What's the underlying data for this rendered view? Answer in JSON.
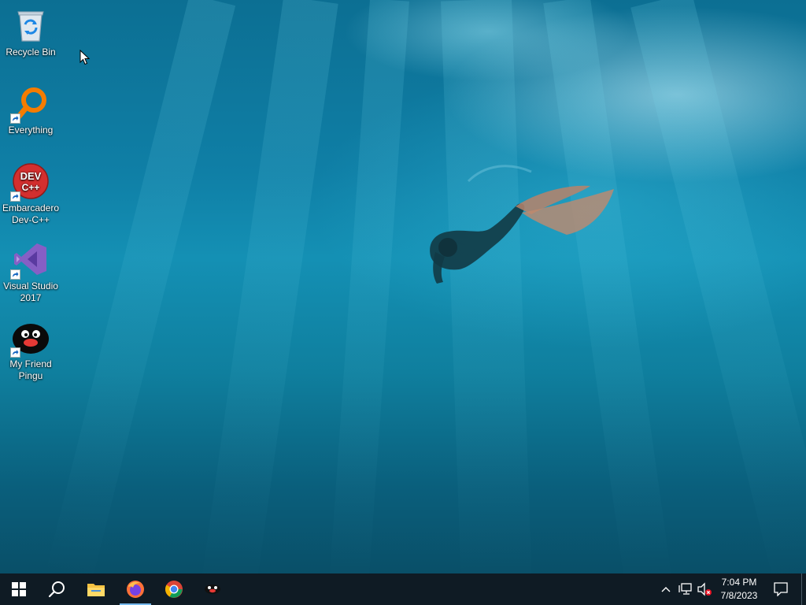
{
  "desktop": {
    "icons": [
      {
        "label": "Recycle Bin",
        "icon": "recycle-bin-icon"
      },
      {
        "label": "Everything",
        "icon": "everything-search-icon"
      },
      {
        "label": "Embarcadero Dev-C++",
        "icon": "dev-cpp-icon",
        "badge": "DEV C++"
      },
      {
        "label": "Visual Studio 2017",
        "icon": "visual-studio-icon"
      },
      {
        "label": "My Friend Pingu",
        "icon": "pingu-icon"
      }
    ]
  },
  "taskbar": {
    "start": "windows-start-icon",
    "search": "search-icon",
    "pinned": [
      "file-explorer-icon",
      "firefox-icon",
      "chrome-icon",
      "pingu-app-icon"
    ],
    "active_app": "firefox-icon",
    "tray": [
      "chevron-up-icon",
      "network-icon",
      "volume-muted-icon",
      "action-center-icon"
    ],
    "time": "7:04 PM",
    "date": "7/8/2023"
  },
  "colors": {
    "taskbar_bg": "#0f1b24",
    "active_indicator": "#76b9ed",
    "water": "#0f7fa6"
  }
}
